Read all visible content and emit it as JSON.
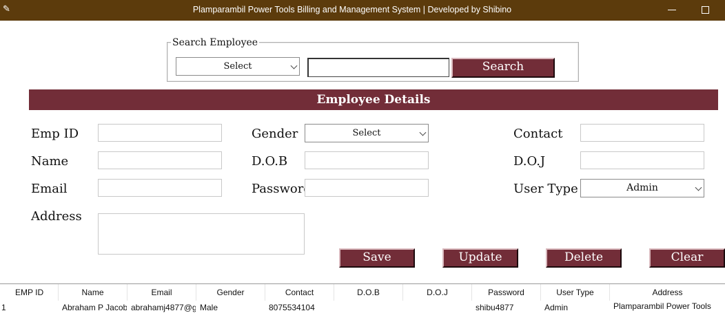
{
  "window": {
    "title": "Plamparambil Power Tools Billing and Management System |  Developed by Shibino",
    "icon": "feather-icon"
  },
  "search": {
    "legend": "Search Employee",
    "select_value": "Select",
    "input_value": "",
    "button_label": "Search"
  },
  "section_title": "Employee Details",
  "form": {
    "emp_id_label": "Emp ID",
    "name_label": "Name",
    "email_label": "Email",
    "address_label": "Address",
    "gender_label": "Gender",
    "gender_value": "Select",
    "dob_label": "D.O.B",
    "password_label": "Password",
    "contact_label": "Contact",
    "doj_label": "D.O.J",
    "user_type_label": "User Type",
    "user_type_value": "Admin"
  },
  "buttons": {
    "save": "Save",
    "update": "Update",
    "delete": "Delete",
    "clear": "Clear"
  },
  "table": {
    "headers": [
      "EMP ID",
      "Name",
      "Email",
      "Gender",
      "Contact",
      "D.O.B",
      "D.O.J",
      "Password",
      "User Type",
      "Address"
    ],
    "rows": [
      [
        "1",
        "Abraham P Jacob",
        "abrahamj4877@g",
        "Male",
        "8075534104",
        "",
        "",
        "shibu4877",
        "Admin",
        "Plamparambil Power Tools"
      ]
    ]
  },
  "colors": {
    "titlebar": "#5c3b0c",
    "accent": "#722d38"
  }
}
